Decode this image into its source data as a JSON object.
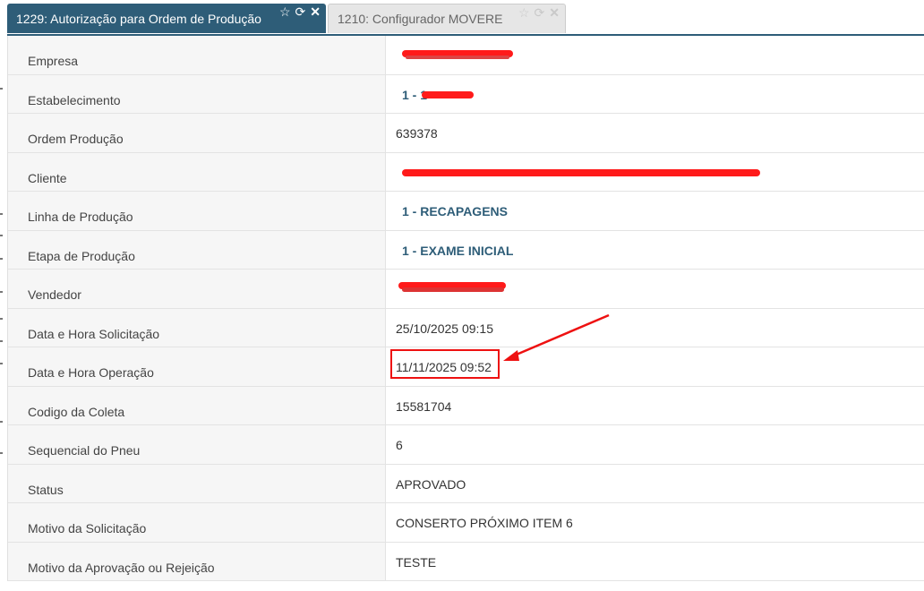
{
  "tabs": [
    {
      "label": "1229: Autorização para Ordem de Produção",
      "active": true
    },
    {
      "label": "1210: Configurador MOVERE",
      "active": false
    }
  ],
  "icons": {
    "favorite": "star-icon",
    "refresh": "refresh-icon",
    "close": "close-icon"
  },
  "rows": [
    {
      "label": "Empresa",
      "value": ""
    },
    {
      "label": "Estabelecimento",
      "value": "1 - 1"
    },
    {
      "label": "Ordem Produção",
      "value": "639378"
    },
    {
      "label": "Cliente",
      "value": ""
    },
    {
      "label": "Linha de Produção",
      "value": "1 - RECAPAGENS"
    },
    {
      "label": "Etapa de Produção",
      "value": "1 - EXAME INICIAL"
    },
    {
      "label": "Vendedor",
      "value": ""
    },
    {
      "label": "Data e Hora Solicitação",
      "value": "25/10/2025 09:15"
    },
    {
      "label": "Data e Hora Operação",
      "value": "11/11/2025 09:52"
    },
    {
      "label": "Codigo da Coleta",
      "value": "15581704"
    },
    {
      "label": "Sequencial do Pneu",
      "value": "6"
    },
    {
      "label": "Status",
      "value": "APROVADO"
    },
    {
      "label": "Motivo da Solicitação",
      "value": "CONSERTO PRÓXIMO ITEM 6"
    },
    {
      "label": "Motivo da Aprovação ou Rejeição",
      "value": "TESTE"
    }
  ],
  "colors": {
    "tab_active": "#2e5d78",
    "link_value": "#2e5d78",
    "annotation": "#ee1111"
  }
}
